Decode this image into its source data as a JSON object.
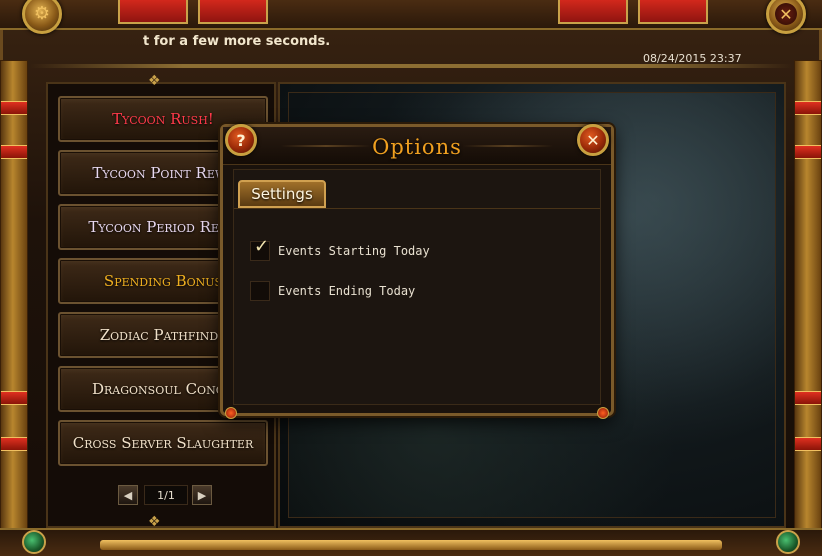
{
  "header": {
    "marquee_text": "t for a few more seconds.",
    "datetime": "08/24/2015 23:37"
  },
  "icons": {
    "settings": "gear-icon",
    "close": "close-icon",
    "help": "help-icon",
    "prev": "arrow-left-icon",
    "next": "arrow-right-icon",
    "check": "checkmark-icon"
  },
  "menu": {
    "items": [
      {
        "label": "Tycoon Rush!",
        "state": "active"
      },
      {
        "label": "Tycoon Point Rewa",
        "state": "normal"
      },
      {
        "label": "Tycoon Period Rewa",
        "state": "normal"
      },
      {
        "label": "Spending Bonus",
        "state": "gold"
      },
      {
        "label": "Zodiac Pathfinde",
        "state": "plain"
      },
      {
        "label": "Dragonsoul Conqu",
        "state": "plain"
      },
      {
        "label": "Cross Server Slaughter",
        "state": "plain"
      }
    ],
    "pager": {
      "prev_glyph": "◀",
      "text": "1/1",
      "next_glyph": "▶"
    }
  },
  "dialog": {
    "title": "Options",
    "help_glyph": "?",
    "close_glyph": "✕",
    "tab_label": "Settings",
    "options": [
      {
        "label": "Events Starting Today",
        "checked": true
      },
      {
        "label": "Events Ending Today",
        "checked": false
      }
    ]
  },
  "colors": {
    "menu_active": "#ff3a4a",
    "menu_gold": "#f0b020",
    "dialog_title": "#f0a020",
    "frame_gold": "#c9a24a"
  }
}
